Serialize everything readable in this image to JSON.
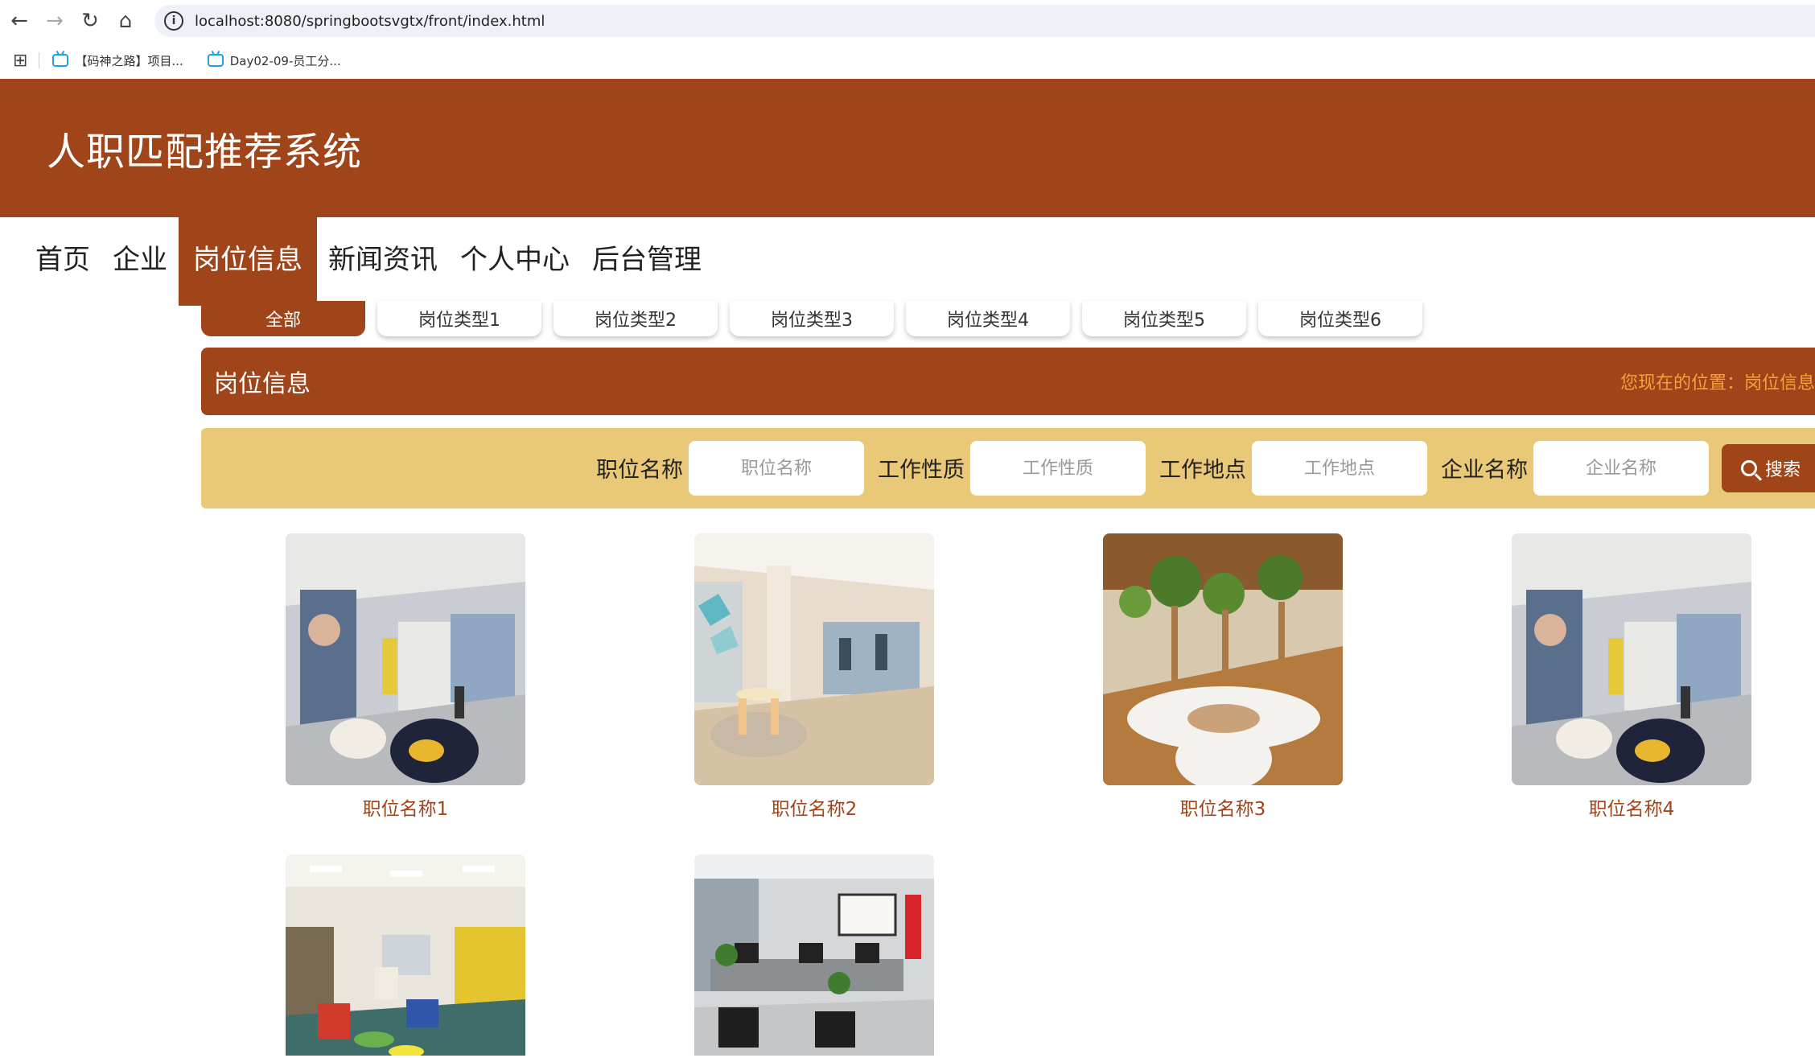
{
  "browser": {
    "url": "localhost:8080/springbootsvgtx/front/index.html",
    "bookmarks": [
      "【码神之路】项目...",
      "Day02-09-员工分..."
    ]
  },
  "site": {
    "title": "人职匹配推荐系统"
  },
  "nav": {
    "items": [
      "首页",
      "企业",
      "岗位信息",
      "新闻资讯",
      "个人中心",
      "后台管理"
    ],
    "active": 2
  },
  "categories": {
    "items": [
      "全部",
      "岗位类型1",
      "岗位类型2",
      "岗位类型3",
      "岗位类型4",
      "岗位类型5",
      "岗位类型6"
    ],
    "active": 0
  },
  "section": {
    "title": "岗位信息",
    "breadcrumb": "您现在的位置：岗位信息"
  },
  "search": {
    "fields": [
      {
        "label": "职位名称",
        "placeholder": "职位名称"
      },
      {
        "label": "工作性质",
        "placeholder": "工作性质"
      },
      {
        "label": "工作地点",
        "placeholder": "工作地点"
      },
      {
        "label": "企业名称",
        "placeholder": "企业名称"
      }
    ],
    "button": "搜索"
  },
  "jobs": [
    {
      "name": "职位名称1",
      "image": "modern office lounge"
    },
    {
      "name": "职位名称2",
      "image": "bright office corridor"
    },
    {
      "name": "职位名称3",
      "image": "office with trees"
    },
    {
      "name": "职位名称4",
      "image": "modern office lounge"
    },
    {
      "name": "",
      "image": "colorful lounge"
    },
    {
      "name": "",
      "image": "office workstations"
    }
  ],
  "colors": {
    "brand": "#a0441a",
    "search_bg": "#e9c877",
    "breadcrumb": "#f5a23c"
  }
}
